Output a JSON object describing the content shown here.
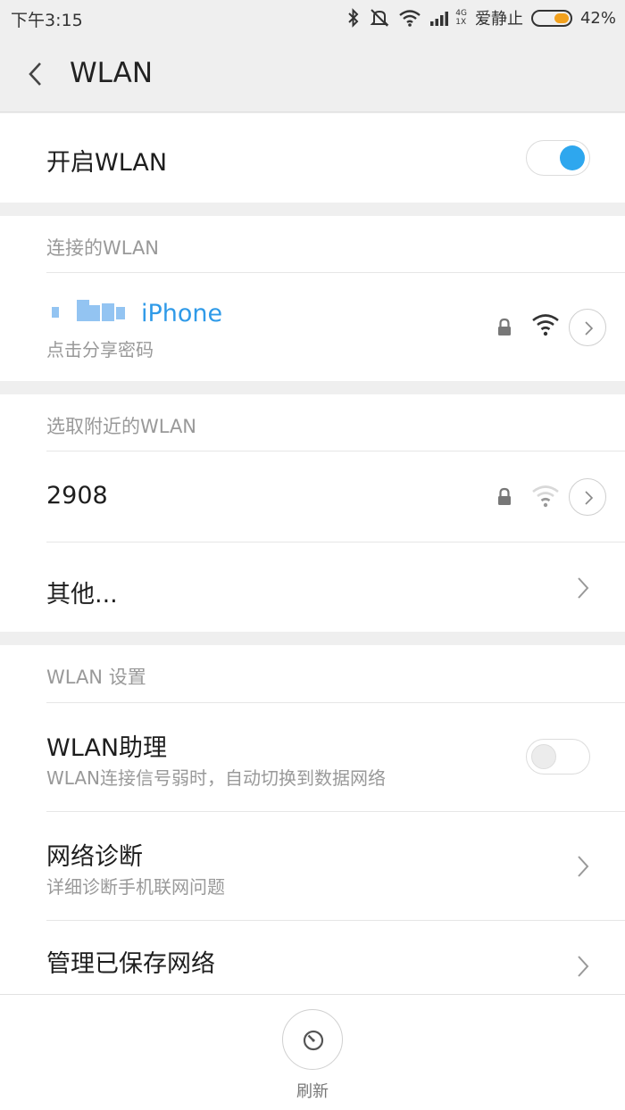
{
  "status_bar": {
    "time": "下午3:15",
    "network_top": "4G",
    "network_bottom": "1X",
    "carrier": "爱静止",
    "battery_percent": "42%",
    "battery_level": 0.42
  },
  "app_bar": {
    "title": "WLAN"
  },
  "wlan_toggle": {
    "label": "开启WLAN",
    "on": true
  },
  "connected": {
    "section_title": "连接的WLAN",
    "ssid": "iPhone",
    "subtitle": "点击分享密码"
  },
  "nearby": {
    "section_title": "选取附近的WLAN",
    "networks": [
      {
        "ssid": "2908"
      }
    ],
    "other_label": "其他..."
  },
  "settings": {
    "section_title": "WLAN 设置",
    "assistant": {
      "title": "WLAN助理",
      "subtitle": "WLAN连接信号弱时，自动切换到数据网络",
      "on": false
    },
    "diagnose": {
      "title": "网络诊断",
      "subtitle": "详细诊断手机联网问题"
    },
    "saved": {
      "title": "管理已保存网络"
    }
  },
  "bottom": {
    "refresh_label": "刷新"
  },
  "colors": {
    "accent": "#2ea7ee",
    "battery": "#f2a11e",
    "background": "#efefef"
  }
}
